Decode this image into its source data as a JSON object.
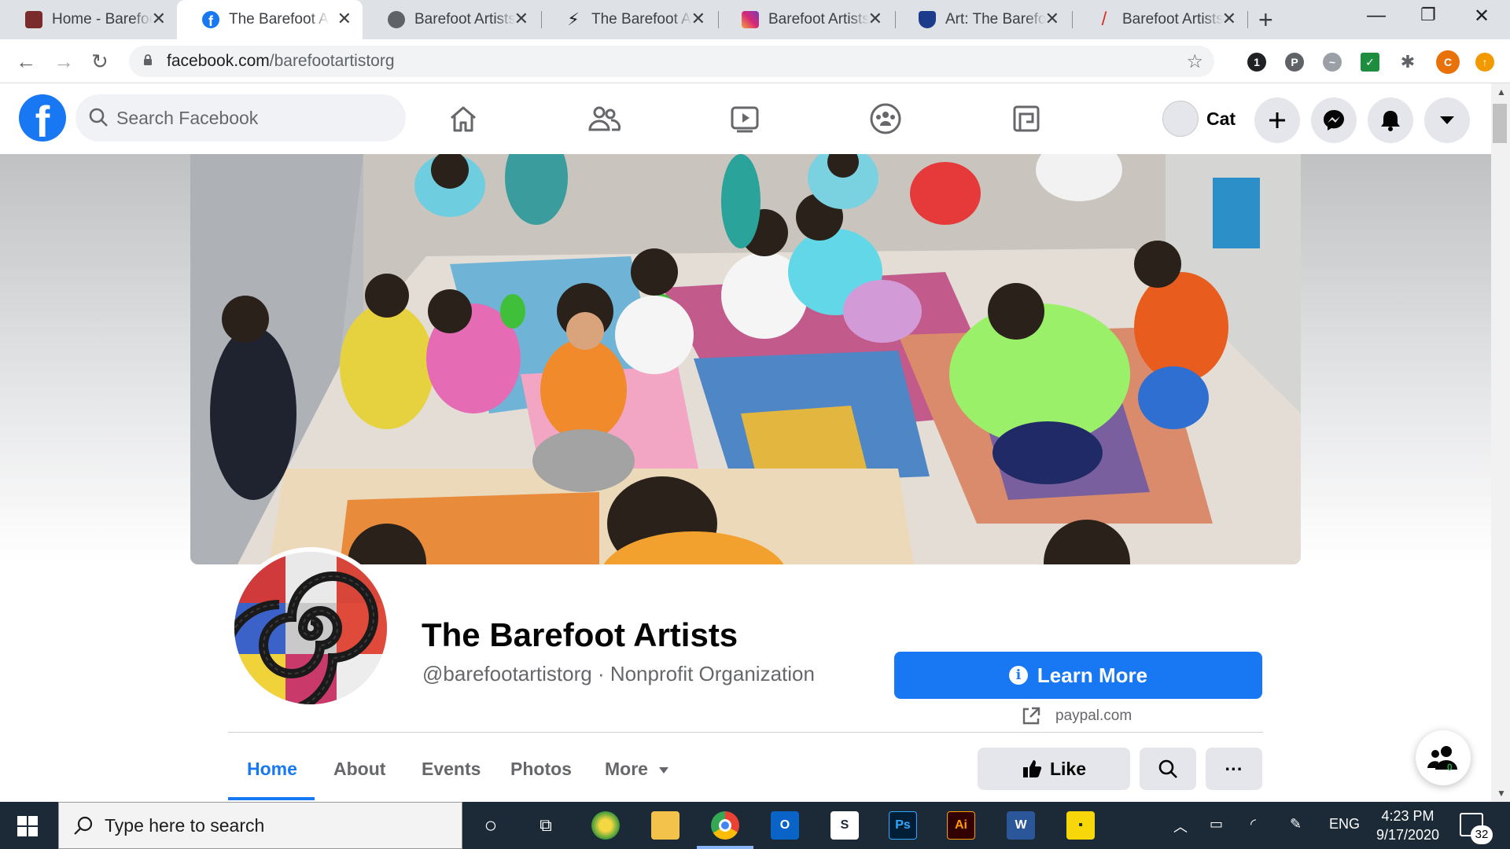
{
  "browser": {
    "tabs": [
      {
        "title": "Home - Barefoot Artists",
        "icon": "barefoot-favicon",
        "active": false
      },
      {
        "title": "The Barefoot Artists",
        "icon": "facebook-icon",
        "active": true
      },
      {
        "title": "Barefoot Artists",
        "icon": "globe-icon",
        "active": false
      },
      {
        "title": "The Barefoot Artists",
        "icon": "lightning-icon",
        "active": false
      },
      {
        "title": "Barefoot Artists",
        "icon": "instagram-icon",
        "active": false
      },
      {
        "title": "Art: The Barefoot Artists",
        "icon": "shield-icon",
        "active": false
      },
      {
        "title": "Barefoot Artists",
        "icon": "slash-icon",
        "active": false
      }
    ],
    "url_domain": "facebook.com",
    "url_path": "/barefootartistorg",
    "profile_initial": "C",
    "extension_badge": "1"
  },
  "facebook": {
    "search_placeholder": "Search Facebook",
    "user_name": "Cat",
    "brand_color": "#1877f2"
  },
  "page": {
    "name": "The Barefoot Artists",
    "subtitle": "@barefootartistorg · Nonprofit Organization",
    "cta_label": "Learn More",
    "cta_link": "paypal.com",
    "tabs": [
      {
        "label": "Home",
        "active": true
      },
      {
        "label": "About",
        "active": false
      },
      {
        "label": "Events",
        "active": false
      },
      {
        "label": "Photos",
        "active": false
      },
      {
        "label": "More",
        "active": false
      }
    ],
    "like_label": "Like",
    "more_actions": "···",
    "people_badge": "0"
  },
  "taskbar": {
    "search_placeholder": "Type here to search",
    "language": "ENG",
    "time": "4:23 PM",
    "date": "9/17/2020",
    "notification_count": "32"
  }
}
